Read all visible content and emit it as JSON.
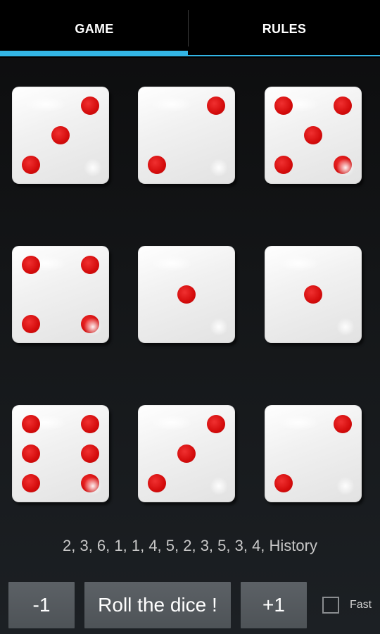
{
  "tabs": [
    {
      "label": "GAME",
      "selected": true
    },
    {
      "label": "RULES",
      "selected": false
    }
  ],
  "accent_color": "#33b5e5",
  "pip_color": "#d40c0c",
  "dice": [
    3,
    2,
    5,
    4,
    1,
    1,
    6,
    3,
    2
  ],
  "history": "2, 3, 6, 1, 1, 4, 5, 2, 3, 5, 3, 4, History",
  "controls": {
    "minus_label": "-1",
    "roll_label": "Roll the dice !",
    "plus_label": "+1",
    "fast_label": "Fast",
    "fast_checked": false
  }
}
